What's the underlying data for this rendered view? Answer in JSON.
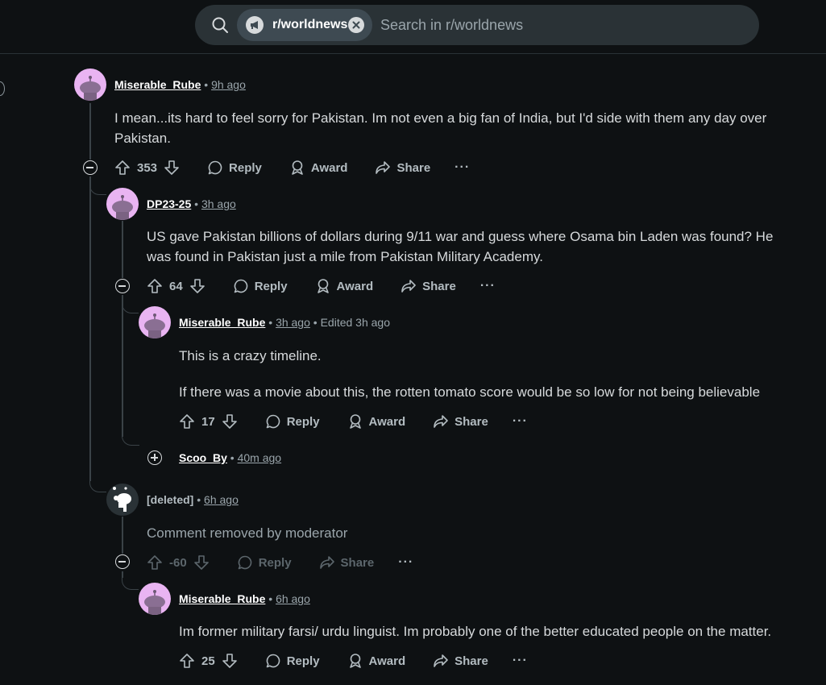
{
  "search": {
    "community": "r/worldnews",
    "placeholder": "Search in r/worldnews"
  },
  "labels": {
    "reply": "Reply",
    "award": "Award",
    "share": "Share",
    "more": "···"
  },
  "comments": [
    {
      "user": "Miserable_Rube",
      "time": "9h ago",
      "body": "I mean...its hard to feel sorry for Pakistan. Im not even a big fan of India, but I'd side with them any day over Pakistan.",
      "votes": "353"
    },
    {
      "user": "DP23-25",
      "time": "3h ago",
      "body": "US gave Pakistan billions of dollars during 9/11 war and guess where Osama bin Laden was found? He was found in Pakistan just a mile from Pakistan Military Academy.",
      "votes": "64"
    },
    {
      "user": "Miserable_Rube",
      "time": "3h ago",
      "edited": "Edited 3h ago",
      "body1": "This is a crazy timeline.",
      "body2": "If there was a movie about this, the rotten tomato score would be so low for not being believable",
      "votes": "17"
    },
    {
      "user": "Scoo_By",
      "time": "40m ago"
    },
    {
      "user": "[deleted]",
      "time": "6h ago",
      "body": "Comment removed by moderator",
      "votes": "-60"
    },
    {
      "user": "Miserable_Rube",
      "time": "6h ago",
      "body": "Im former military farsi/ urdu linguist. Im probably one of the better educated people on the matter.",
      "votes": "25"
    }
  ],
  "colors": {
    "background": "#0e1113",
    "avatar": "#e9b4f2",
    "search_bg": "#2a3236"
  }
}
